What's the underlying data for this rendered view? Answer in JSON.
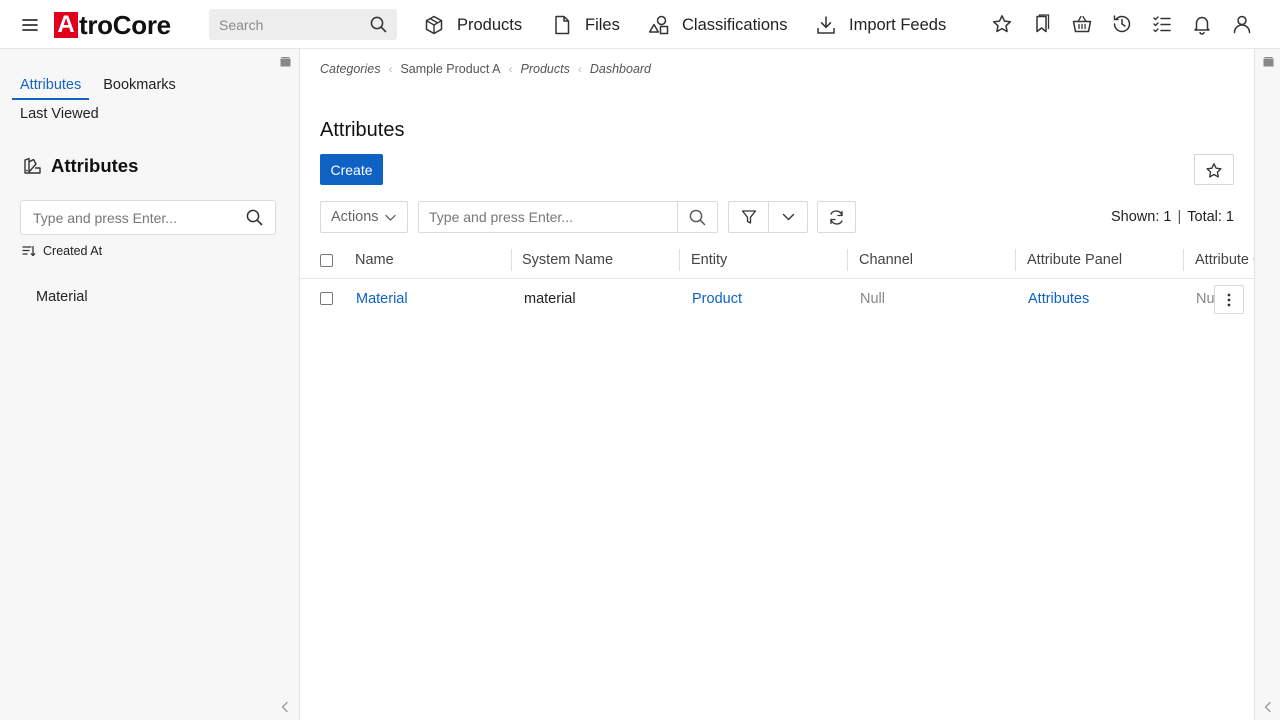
{
  "header": {
    "logo_letter": "A",
    "logo_rest": "troCore",
    "search_placeholder": "Search",
    "nav": [
      {
        "label": "Products",
        "icon": "cube-icon"
      },
      {
        "label": "Files",
        "icon": "file-icon"
      },
      {
        "label": "Classifications",
        "icon": "shapes-icon"
      },
      {
        "label": "Import Feeds",
        "icon": "download-icon"
      }
    ],
    "right_icons": [
      "star-icon",
      "bookmark-icon",
      "basket-icon",
      "history-icon",
      "checklist-icon",
      "bell-icon",
      "user-icon"
    ]
  },
  "sidebar": {
    "tabs": [
      "Attributes",
      "Bookmarks"
    ],
    "active_tab": "Attributes",
    "second_row_tab": "Last Viewed",
    "title": "Attributes",
    "search_placeholder": "Type and press Enter...",
    "sort_label": "Created At",
    "items": [
      "Material"
    ]
  },
  "main": {
    "breadcrumb": [
      "Categories",
      "Sample Product A",
      "Products",
      "Dashboard"
    ],
    "title": "Attributes",
    "create_label": "Create",
    "actions_label": "Actions",
    "search_placeholder": "Type and press Enter...",
    "shown_label": "Shown: 1",
    "total_label": "Total: 1",
    "separator": "|",
    "columns": [
      "Name",
      "System Name",
      "Entity",
      "Channel",
      "Attribute Panel",
      "Attribute G"
    ],
    "rows": [
      {
        "name": "Material",
        "system_name": "material",
        "entity": "Product",
        "channel": "Null",
        "attribute_panel": "Attributes",
        "attribute_group": "Nu"
      }
    ]
  },
  "colors": {
    "accent": "#0d62c4",
    "logo_red": "#e0001b",
    "sidebar_bg": "#f7f7f7"
  }
}
